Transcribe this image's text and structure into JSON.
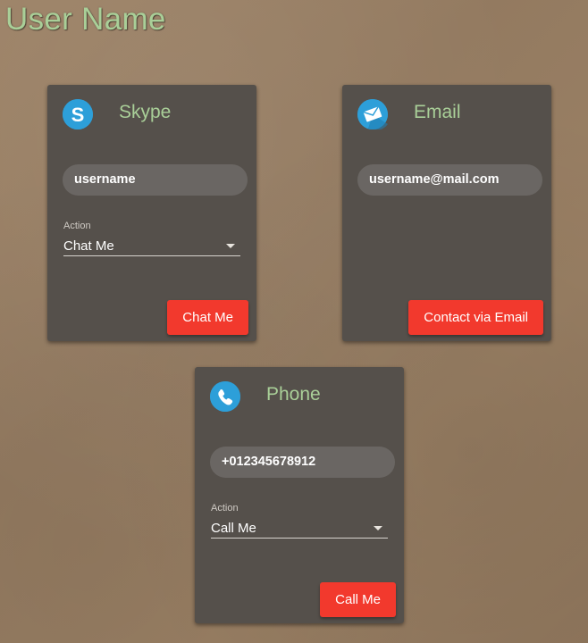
{
  "page": {
    "title": "User Name"
  },
  "colors": {
    "card_bg": "#55504b",
    "title_green": "#a9cf98",
    "button_red": "#f2392d",
    "icon_blue": "#2d9fd9"
  },
  "cards": {
    "skype": {
      "icon": "skype-icon",
      "title": "Skype",
      "value": "username",
      "action_label": "Action",
      "action_value": "Chat Me",
      "button": "Chat Me"
    },
    "email": {
      "icon": "mail-envelope-icon",
      "title": "Email",
      "value": "username@mail.com",
      "button": "Contact via Email"
    },
    "phone": {
      "icon": "phone-icon",
      "title": "Phone",
      "value": "+012345678912",
      "action_label": "Action",
      "action_value": "Call Me",
      "button": "Call Me"
    }
  }
}
